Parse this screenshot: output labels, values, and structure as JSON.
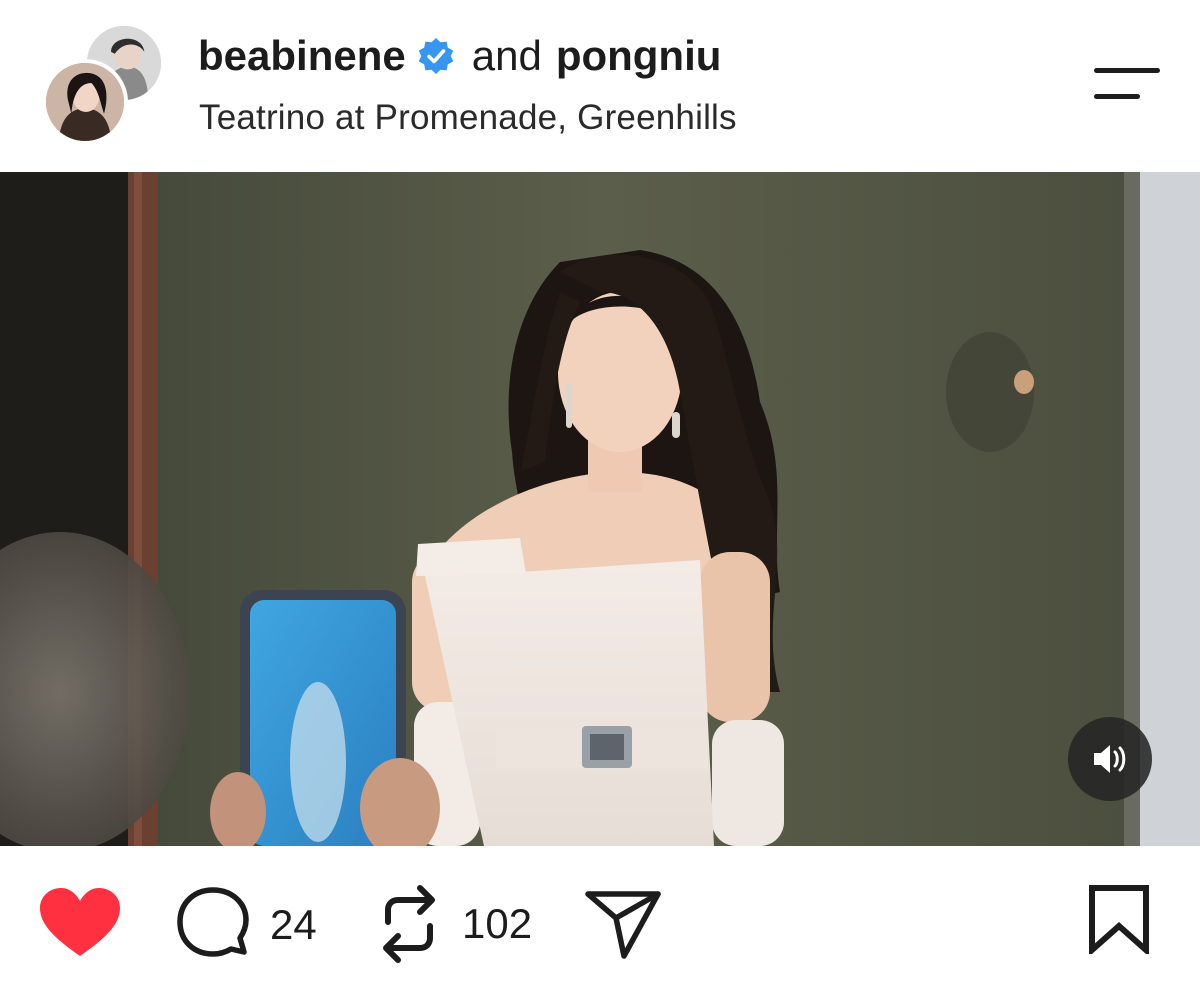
{
  "post": {
    "author": {
      "username": "beabinene",
      "verified": true
    },
    "connector": "and",
    "collaborator": {
      "username": "pongniu"
    },
    "location": "Teatrino at Promenade, Greenhills"
  },
  "actions": {
    "liked": true,
    "comments_count": "24",
    "reposts_count": "102"
  },
  "icons": {
    "menu": "hamburger-menu-icon",
    "verified": "verified-badge-icon",
    "like": "heart-icon",
    "comment": "comment-bubble-icon",
    "repost": "repost-icon",
    "share": "send-icon",
    "save": "bookmark-icon",
    "sound": "speaker-icon"
  },
  "colors": {
    "verified_blue": "#3797f0",
    "like_red": "#ff3040",
    "text": "#1c1c1c"
  }
}
